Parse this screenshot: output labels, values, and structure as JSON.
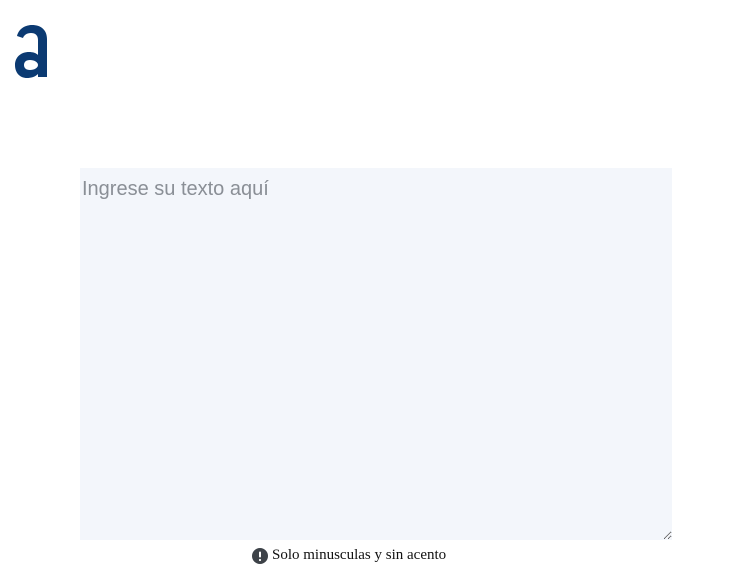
{
  "logo": {
    "glyph": "a",
    "color": "#0b3a72",
    "icon": "brand-logo-icon"
  },
  "editor": {
    "placeholder": "Ingrese su texto aquí",
    "value": "",
    "background": "#f3f6fb"
  },
  "hint": {
    "icon": "exclamation-circle-icon",
    "text": "Solo minusculas y sin acento"
  }
}
